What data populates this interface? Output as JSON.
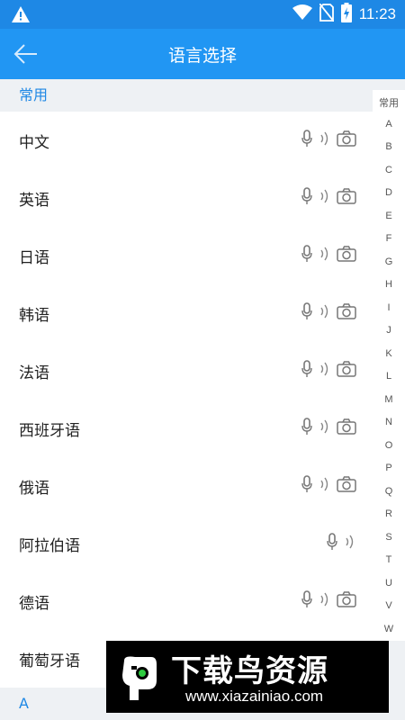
{
  "status_bar": {
    "time": "11:23",
    "icons": [
      "warning-icon",
      "wifi-icon",
      "no-sim-icon",
      "battery-charging-icon"
    ]
  },
  "app_bar": {
    "title": "语言选择",
    "back_icon": "arrow-left-icon"
  },
  "sections": [
    {
      "header": "常用"
    },
    {
      "header": "A"
    }
  ],
  "languages": [
    {
      "label": "中文",
      "icons": [
        "mic-icon",
        "sound-icon",
        "camera-icon"
      ]
    },
    {
      "label": "英语",
      "icons": [
        "mic-icon",
        "sound-icon",
        "camera-icon"
      ]
    },
    {
      "label": "日语",
      "icons": [
        "mic-icon",
        "sound-icon",
        "camera-icon"
      ]
    },
    {
      "label": "韩语",
      "icons": [
        "mic-icon",
        "sound-icon",
        "camera-icon"
      ]
    },
    {
      "label": "法语",
      "icons": [
        "mic-icon",
        "sound-icon",
        "camera-icon"
      ]
    },
    {
      "label": "西班牙语",
      "icons": [
        "mic-icon",
        "sound-icon",
        "camera-icon"
      ]
    },
    {
      "label": "俄语",
      "icons": [
        "mic-icon",
        "sound-icon",
        "camera-icon"
      ]
    },
    {
      "label": "阿拉伯语",
      "icons": [
        "mic-icon",
        "sound-icon"
      ]
    },
    {
      "label": "德语",
      "icons": [
        "mic-icon",
        "sound-icon",
        "camera-icon"
      ]
    },
    {
      "label": "葡萄牙语",
      "icons": []
    }
  ],
  "index_bar": [
    "常用",
    "A",
    "B",
    "C",
    "D",
    "E",
    "F",
    "G",
    "H",
    "I",
    "J",
    "K",
    "L",
    "M",
    "N",
    "O",
    "P",
    "Q",
    "R",
    "S",
    "T",
    "U",
    "V",
    "W"
  ],
  "watermark": {
    "title": "下载鸟资源",
    "url": "www.xiazainiao.com"
  },
  "colors": {
    "app_bar": "#2196f3",
    "status_bar": "#1e88e5",
    "section_text": "#1e88e5",
    "background": "#eef1f4"
  }
}
